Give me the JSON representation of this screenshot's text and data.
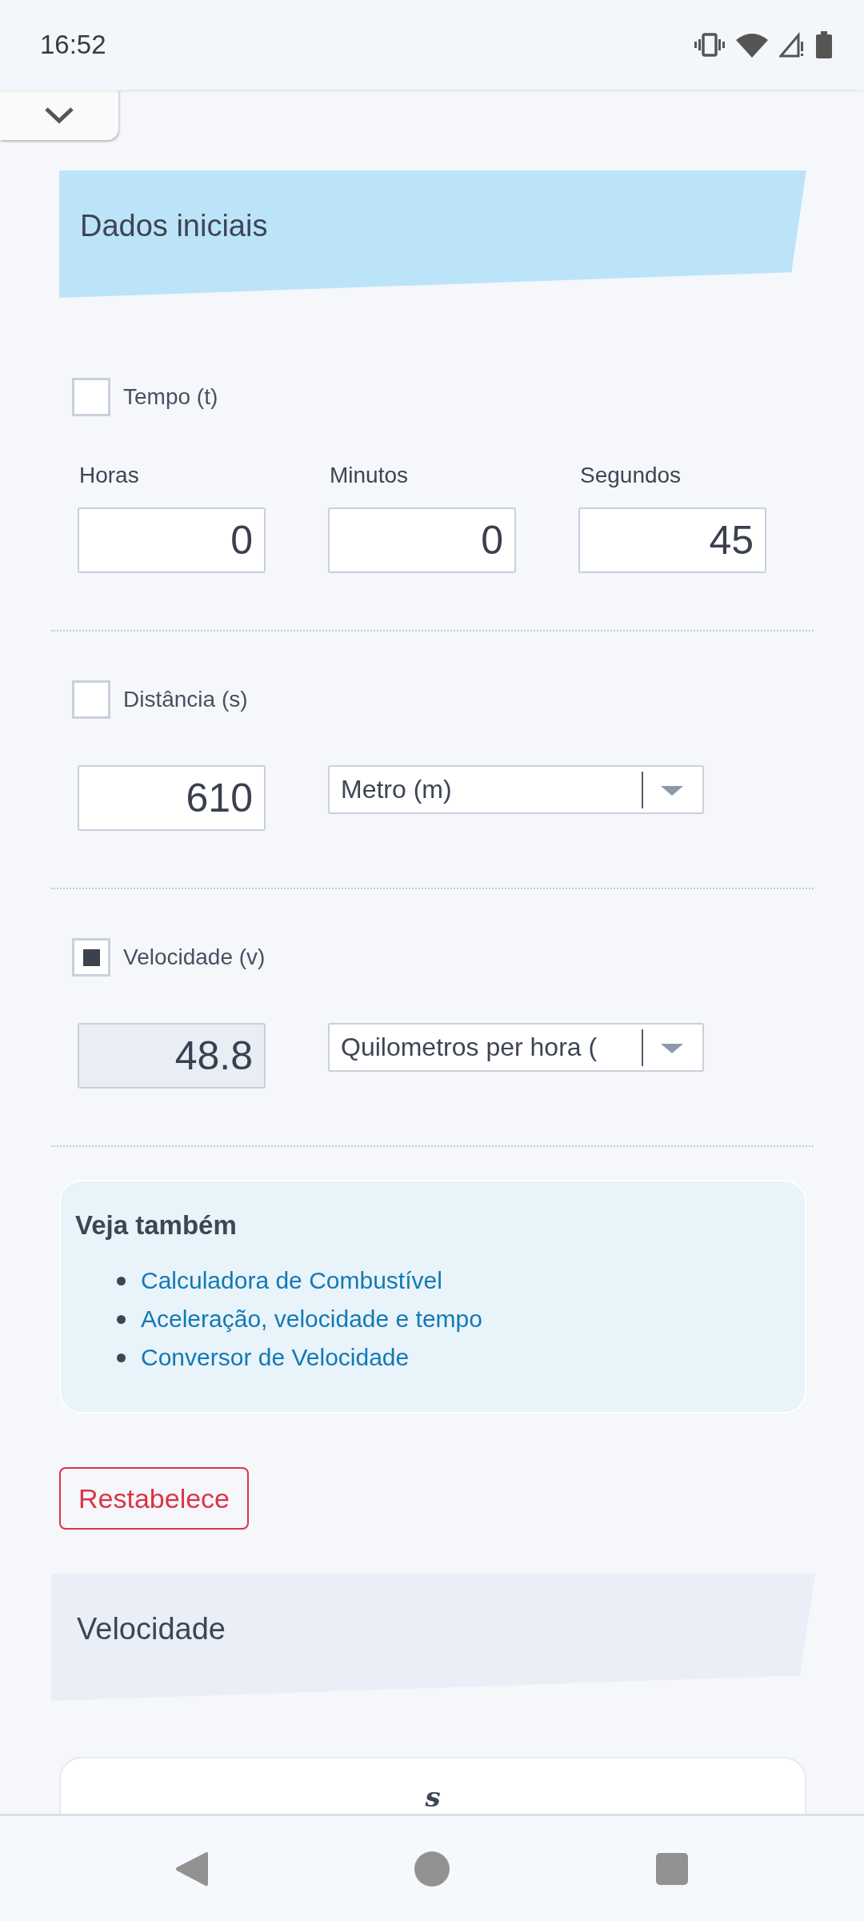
{
  "status_bar": {
    "time": "16:52"
  },
  "header": {
    "title": "Dados iniciais"
  },
  "variables": [
    {
      "kind": "time",
      "label": "Tempo (t)",
      "checked": false,
      "fields": [
        {
          "label": "Horas",
          "value": "0"
        },
        {
          "label": "Minutos",
          "value": "0"
        },
        {
          "label": "Segundos",
          "value": "45"
        }
      ]
    },
    {
      "kind": "quantity",
      "label": "Distância (s)",
      "checked": false,
      "value": "610",
      "disabled": false,
      "unit": "Metro (m)"
    },
    {
      "kind": "quantity",
      "label": "Velocidade (v)",
      "checked": true,
      "value": "48.8",
      "disabled": true,
      "unit": "Quilometros per hora ("
    }
  ],
  "see_also": {
    "title": "Veja também",
    "links": [
      "Calculadora de Combustível",
      "Aceleração, velocidade e tempo",
      "Conversor de Velocidade"
    ]
  },
  "reset_button": "Restabelece",
  "result": {
    "title": "Velocidade",
    "formula_numerator": "s"
  }
}
